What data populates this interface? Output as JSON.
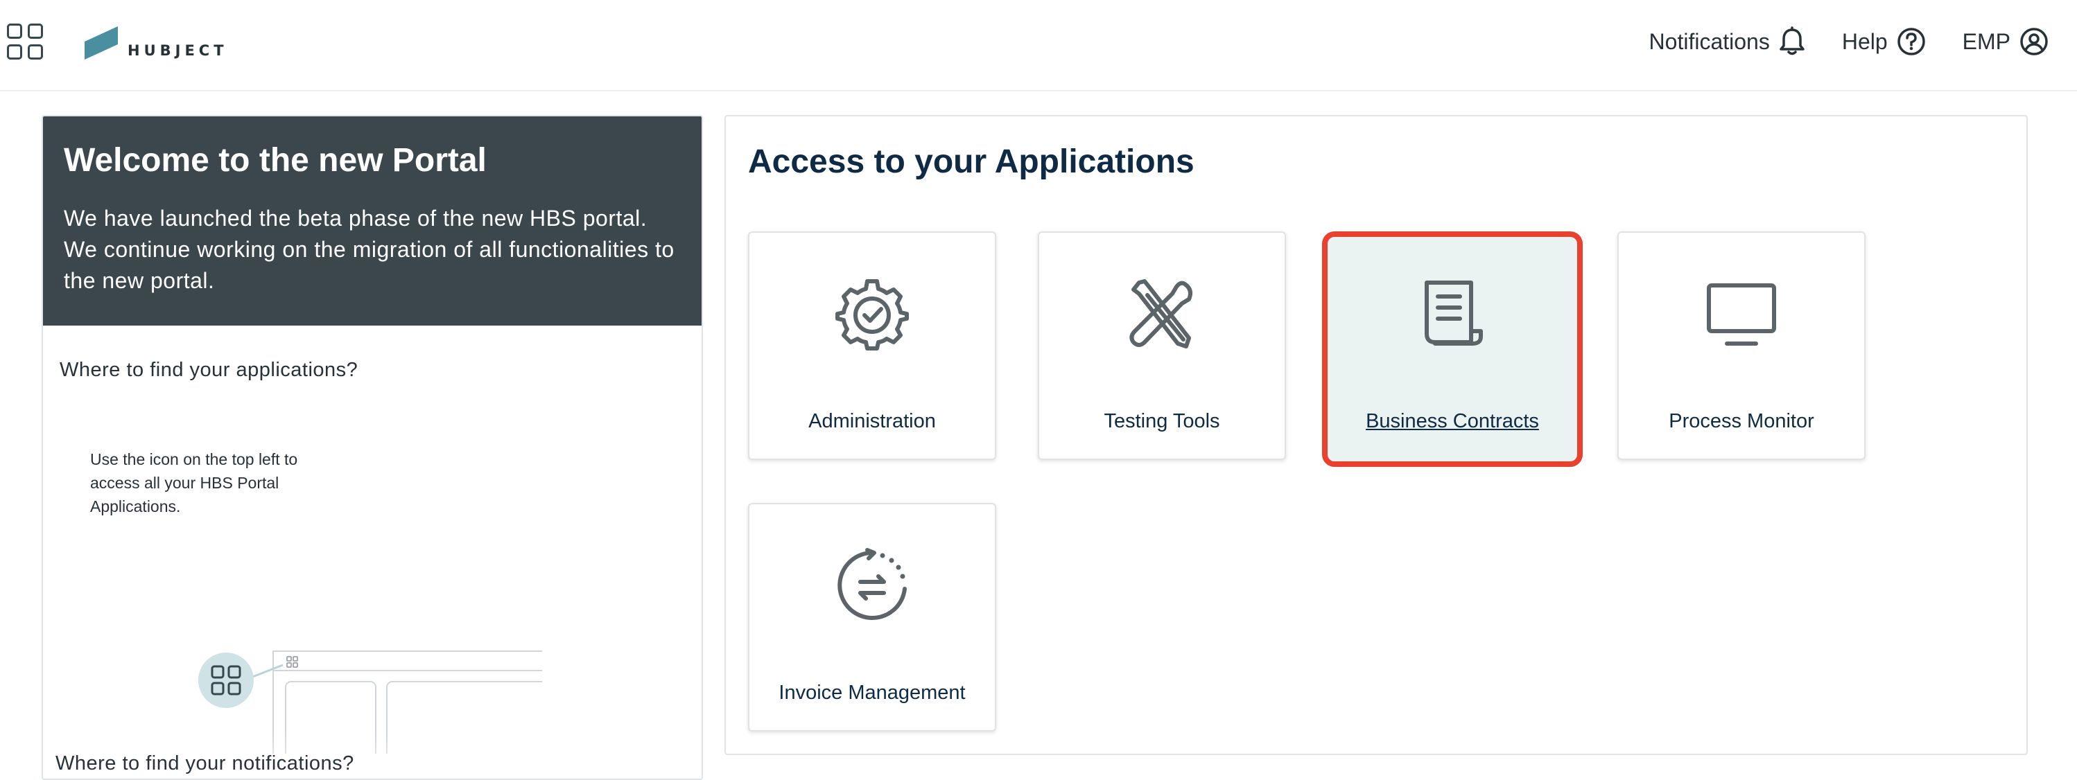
{
  "header": {
    "logo_text": "HUBJECT",
    "nav": {
      "notifications": "Notifications",
      "help": "Help",
      "account": "EMP"
    }
  },
  "welcome": {
    "title": "Welcome to the new Portal",
    "text": "We have launched the beta phase of the new HBS portal. We continue working on the migration of all functionalities to the new portal.",
    "where_title": "Where to find your applications?",
    "hint_text": "Use the icon on the top left to access all your HBS Portal Applications.",
    "where_title_2": "Where to find your notifications?"
  },
  "applications": {
    "title": "Access to your Applications",
    "tiles": [
      {
        "label": "Administration",
        "icon": "gear-check-icon",
        "selected": false
      },
      {
        "label": "Testing Tools",
        "icon": "tools-icon",
        "selected": false
      },
      {
        "label": "Business Contracts",
        "icon": "document-scroll-icon",
        "selected": true
      },
      {
        "label": "Process Monitor",
        "icon": "monitor-icon",
        "selected": false
      },
      {
        "label": "Invoice Management",
        "icon": "invoice-cycle-icon",
        "selected": false
      }
    ]
  },
  "colors": {
    "hero_bg": "#3c474d",
    "title_text": "#0f2a44",
    "logo_accent": "#4a8fa0",
    "highlight_border": "#e8412e",
    "highlight_bg": "#eaf2f2"
  }
}
